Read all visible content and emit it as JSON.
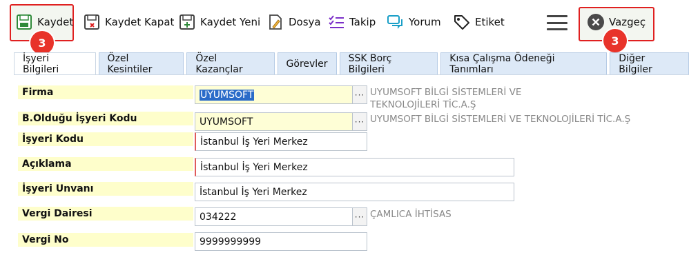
{
  "toolbar": {
    "save": "Kaydet",
    "save_close": "Kaydet Kapat",
    "save_new": "Kaydet Yeni",
    "file": "Dosya",
    "follow": "Takip",
    "comment": "Yorum",
    "tag": "Etiket",
    "cancel": "Vazgeç",
    "badge_save": "3",
    "badge_cancel": "3"
  },
  "tabs": [
    "İşyeri Bilgileri",
    "Özel Kesintiler",
    "Özel Kazançlar",
    "Görevler",
    "SSK Borç Bilgileri",
    "Kısa Çalışma Ödeneği Tanımları",
    "Diğer Bilgiler"
  ],
  "form": {
    "firma": {
      "label": "Firma",
      "value": "UYUMSOFT",
      "desc_line1": "UYUMSOFT BİLGİ SİSTEMLERİ VE",
      "desc_line2": "TEKNOLOJİLERİ TİC.A.Ş"
    },
    "bagli": {
      "label": "B.Olduğu İşyeri Kodu",
      "value": "UYUMSOFT",
      "desc": "UYUMSOFT BİLGİ SİSTEMLERİ VE TEKNOLOJİLERİ TİC.A.Ş"
    },
    "isyeri_kodu": {
      "label": "İşyeri Kodu",
      "value": "İstanbul İş Yeri Merkez"
    },
    "aciklama": {
      "label": "Açıklama",
      "value": "İstanbul İş Yeri Merkez"
    },
    "unvan": {
      "label": "İşyeri Unvanı",
      "value": "İstanbul İş Yeri Merkez"
    },
    "vergi_dairesi": {
      "label": "Vergi Dairesi",
      "value": "034222",
      "desc": "ÇAMLICA İHTİSAS"
    },
    "vergi_no": {
      "label": "Vergi No",
      "value": "9999999999"
    }
  },
  "lookup_label": "···"
}
